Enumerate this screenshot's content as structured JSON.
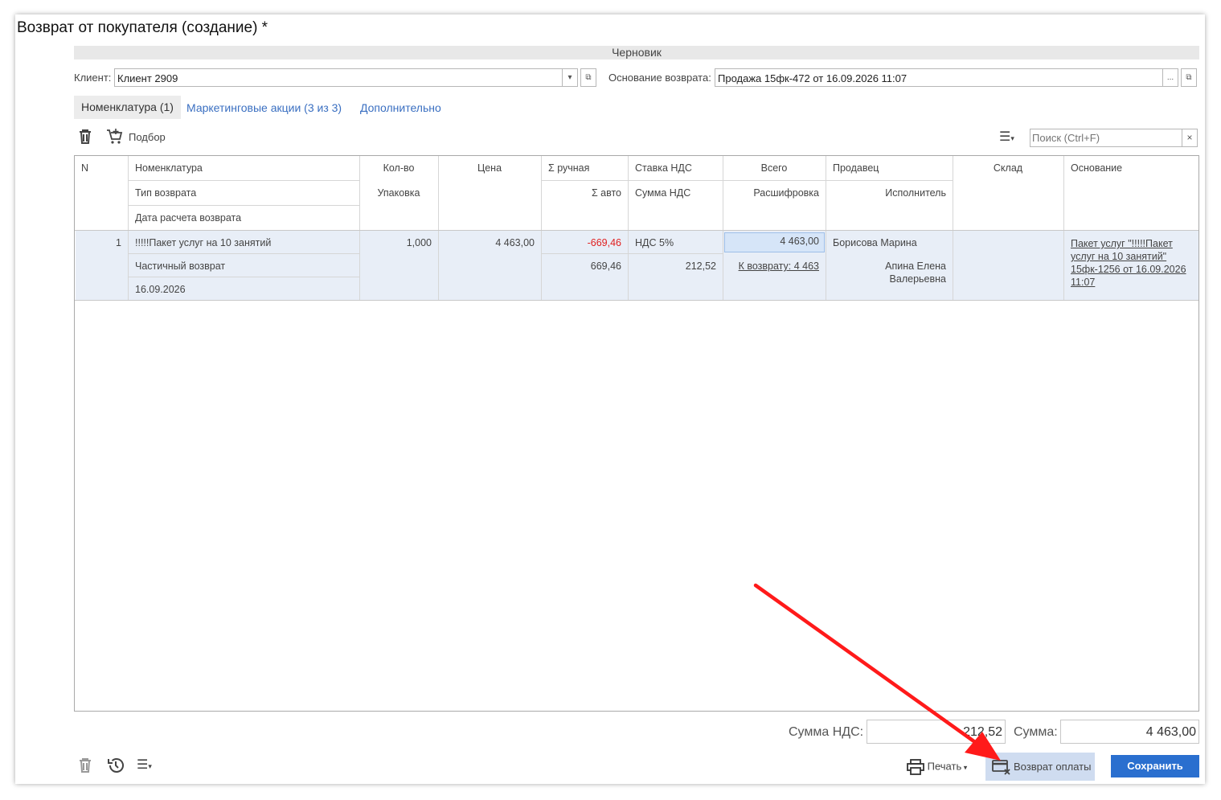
{
  "window": {
    "title": "Возврат от покупателя (создание) *",
    "status": "Черновик"
  },
  "header": {
    "client_label": "Клиент:",
    "client_value": "Клиент 2909",
    "basis_label": "Основание возврата:",
    "basis_value": "Продажа 15фк-472 от 16.09.2026 11:07"
  },
  "tabs": [
    {
      "label": "Номенклатура (1)",
      "active": true
    },
    {
      "label": "Маркетинговые акции (3 из 3)",
      "active": false
    },
    {
      "label": "Дополнительно",
      "active": false
    }
  ],
  "toolbar": {
    "pick_label": "Подбор",
    "search_placeholder": "Поиск (Ctrl+F)",
    "clear_label": "×"
  },
  "table": {
    "headers": {
      "n": "N",
      "nomenclature": "Номенклатура",
      "return_type": "Тип возврата",
      "return_date": "Дата расчета возврата",
      "qty": "Кол-во",
      "package": "Упаковка",
      "price": "Цена",
      "sum_manual": "Σ ручная",
      "sum_auto": "Σ авто",
      "vat_rate": "Ставка НДС",
      "vat_sum": "Сумма НДС",
      "total": "Всего",
      "breakdown": "Расшифровка",
      "seller": "Продавец",
      "performer": "Исполнитель",
      "warehouse": "Склад",
      "basis": "Основание"
    },
    "rows": [
      {
        "n": "1",
        "nomenclature": "!!!!!Пакет услуг на 10 занятий",
        "return_type": "Частичный возврат",
        "return_date": "16.09.2026",
        "qty": "1,000",
        "package": "",
        "price": "4 463,00",
        "sum_manual": "-669,46",
        "sum_auto": "669,46",
        "vat_rate": "НДС 5%",
        "vat_sum": "212,52",
        "total": "4 463,00",
        "breakdown": "К возврату: 4 463",
        "seller": "Борисова Марина",
        "performer_line1": "Апина Елена",
        "performer_line2": "Валерьевна",
        "warehouse": "",
        "basis_lines": [
          "Пакет услуг \"!!!!!Пакет",
          "услуг на 10 занятий\"",
          "15фк-1256 от 16.09.2026",
          "11:07"
        ]
      }
    ]
  },
  "footer": {
    "vat_label": "Сумма НДС:",
    "vat_value": "212,52",
    "sum_label": "Сумма:",
    "sum_value": "4 463,00",
    "print_label": "Печать",
    "refund_label": "Возврат оплаты",
    "save_label": "Сохранить"
  },
  "colors": {
    "accent": "#2a6fcf",
    "link": "#3a6fc1",
    "negative": "#e02020",
    "selected_row": "#e8eef7",
    "arrow": "#ff1a1a"
  },
  "icons": [
    "trash-icon",
    "cart-plus-icon",
    "list-menu-icon",
    "history-icon",
    "printer-icon",
    "card-refund-icon",
    "open-icon",
    "dropdown-icon",
    "ellipsis-icon"
  ]
}
